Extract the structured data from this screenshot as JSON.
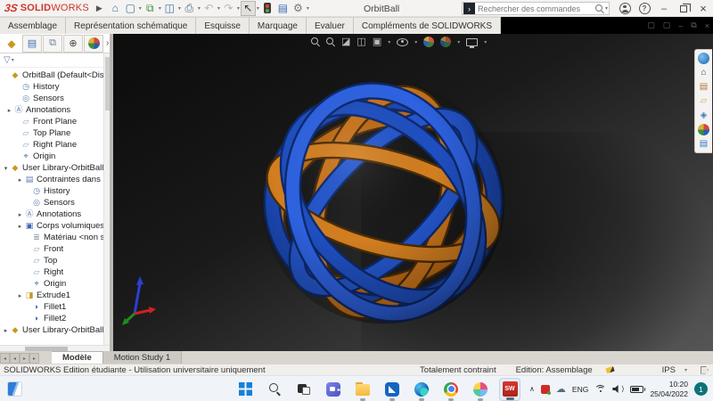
{
  "titlebar": {
    "logo_mark": "3S",
    "logo_solid": "SOLID",
    "logo_works": "WORKS",
    "title": "OrbitBall",
    "search_placeholder": "Rechercher des commandes",
    "search_logo_glyph": "›",
    "minimize_glyph": "–",
    "close_glyph": "×"
  },
  "glyphs": {
    "caret": "▾",
    "home": "⌂",
    "new_doc": "▢",
    "open": "⧉",
    "save": "◫",
    "print": "⎙",
    "undo": "↶",
    "redo": "↷",
    "select": "↖",
    "props": "▤",
    "gear": "⚙",
    "collapsed": "▸",
    "expanded": "▾",
    "more": "›",
    "fm_list": "▤",
    "fm_prop": "⧉",
    "fm_config": "⊕",
    "funnel": "▽",
    "history": "◷",
    "sensors": "◎",
    "annotations": "Ⓐ",
    "plane": "▱",
    "origin": "⌖",
    "component": "◆",
    "mates": "▤",
    "bodies": "▣",
    "material": "≣",
    "extrude": "◨",
    "fillet": "◗",
    "hud_section": "◪",
    "hud_cube": "◫",
    "hud_display": "▣",
    "tp_home": "⌂",
    "tp_library": "▤",
    "tp_folder": "▱",
    "tp_appearance": "◈",
    "tp_props": "▤",
    "nav_left": "◂",
    "nav_right": "▸",
    "panel_box": "▢",
    "restore_doc": "⧉",
    "min_doc": "–",
    "close_doc": "×",
    "tray_chevron": "∧",
    "cloud": "☁",
    "vol_wave": "⟩"
  },
  "command_tabs": [
    "Assemblage",
    "Représentation schématique",
    "Esquisse",
    "Marquage",
    "Evaluer",
    "Compléments de SOLIDWORKS"
  ],
  "tree": {
    "items": [
      {
        "label": "OrbitBall  (Default<Display S"
      },
      {
        "label": "History"
      },
      {
        "label": "Sensors"
      },
      {
        "label": "Annotations"
      },
      {
        "label": "Front Plane"
      },
      {
        "label": "Top Plane"
      },
      {
        "label": "Right Plane"
      },
      {
        "label": "Origin"
      },
      {
        "label": "User Library-OrbitBall_O"
      },
      {
        "label": "Contraintes dans O"
      },
      {
        "label": "History"
      },
      {
        "label": "Sensors"
      },
      {
        "label": "Annotations"
      },
      {
        "label": "Corps volumiques("
      },
      {
        "label": "Matériau <non spé"
      },
      {
        "label": "Front"
      },
      {
        "label": "Top"
      },
      {
        "label": "Right"
      },
      {
        "label": "Origin"
      },
      {
        "label": "Extrude1"
      },
      {
        "label": "Fillet1"
      },
      {
        "label": "Fillet2"
      },
      {
        "label": "User Library-OrbitBall_O"
      }
    ]
  },
  "doc_tabs": {
    "model": "Modèle",
    "motion": "Motion Study 1"
  },
  "status": {
    "left": "SOLIDWORKS Edition étudiante - Utilisation universitaire uniquement",
    "constraint": "Totalement contraint",
    "edition": "Edition: Assemblage",
    "units": "IPS"
  },
  "taskbar": {
    "language": "ENG",
    "time": "10:20",
    "date": "25/04/2022",
    "badge": "1",
    "sw_label": "SW"
  },
  "colors": {
    "accent_red": "#d0342c",
    "band_orange": "#c9741c",
    "band_blue": "#1f4fc0",
    "viewport_bg_dark": "#0e0e0e",
    "taskbar_badge": "#0d7377"
  },
  "icon_names": {
    "toolbar": [
      "home",
      "new-document",
      "open",
      "save",
      "print",
      "undo",
      "redo",
      "select-cursor",
      "xpress-products",
      "properties",
      "options-gear"
    ],
    "hud": [
      "zoom-to-fit",
      "zoom-to-area",
      "section-view",
      "view-orientation",
      "display-style",
      "hide-show-items",
      "edit-appearance",
      "apply-scene",
      "view-settings"
    ],
    "taskpane": [
      "3d-content-central",
      "solidworks-resources",
      "design-library",
      "file-explorer",
      "appearances",
      "scenes",
      "custom-properties"
    ],
    "taskbar": [
      "widgets",
      "start",
      "search",
      "task-view",
      "chat",
      "file-explorer",
      "snip",
      "edge",
      "chrome",
      "photos",
      "solidworks"
    ],
    "tray": [
      "hidden-icons",
      "solidworks-tray",
      "onedrive",
      "language",
      "wifi",
      "volume",
      "battery",
      "clock",
      "notification-badge"
    ]
  }
}
